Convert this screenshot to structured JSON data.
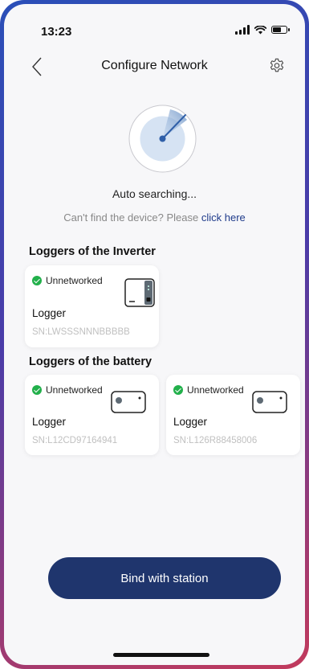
{
  "status_bar": {
    "time": "13:23"
  },
  "header": {
    "title": "Configure Network",
    "back_icon": "chevron-left-icon",
    "settings_icon": "gear-icon"
  },
  "search": {
    "status_text": "Auto searching...",
    "hint_text": "Can't find the device? Please",
    "hint_link": "click here"
  },
  "inverter_section": {
    "title": "Loggers of the Inverter",
    "items": [
      {
        "status": "Unnetworked",
        "name": "Logger",
        "sn": "SN:LWSSSNNNBBBBB"
      }
    ]
  },
  "battery_section": {
    "title": "Loggers of the battery",
    "items": [
      {
        "status": "Unnetworked",
        "name": "Logger",
        "sn": "SN:L12CD97164941"
      },
      {
        "status": "Unnetworked",
        "name": "Logger",
        "sn": "SN:L126R88458006"
      }
    ]
  },
  "footer": {
    "bind_label": "Bind with station"
  },
  "colors": {
    "accent": "#1f356d",
    "success": "#22b04b",
    "link": "#1e3a8a",
    "background": "#f7f7f9"
  }
}
